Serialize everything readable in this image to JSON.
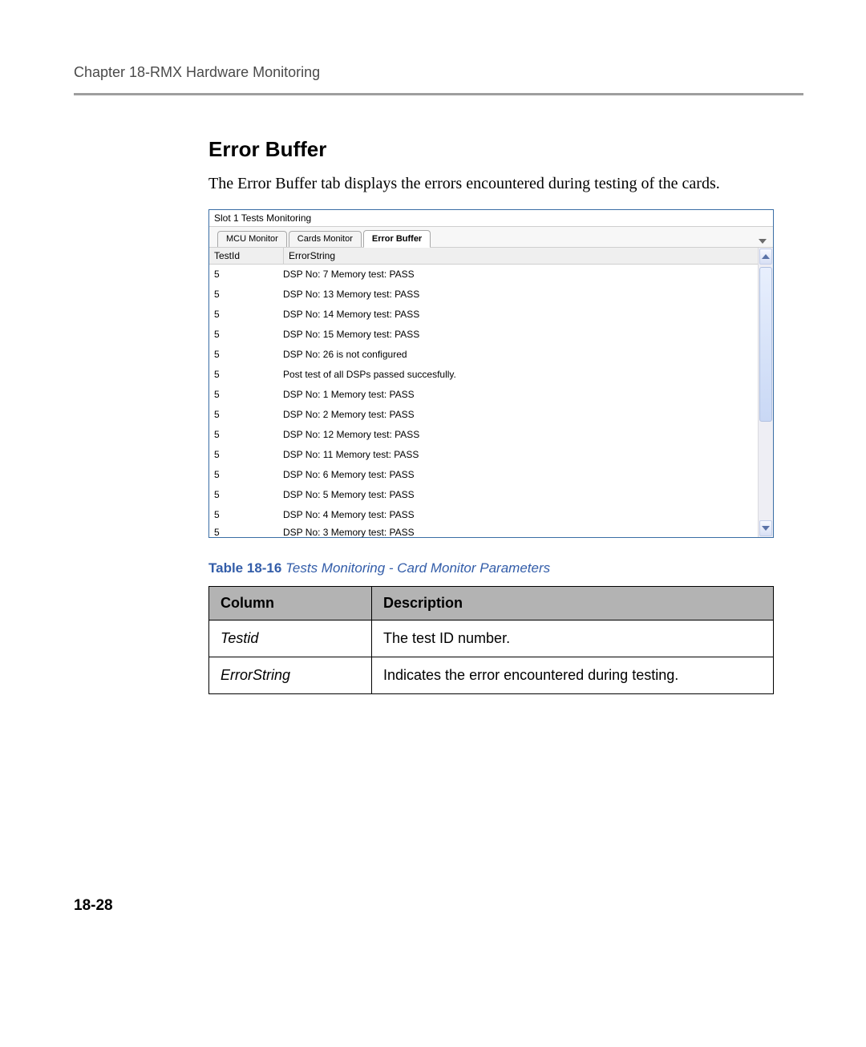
{
  "page": {
    "chapter_title": "Chapter 18-RMX Hardware Monitoring",
    "page_number": "18-28"
  },
  "section": {
    "heading": "Error Buffer",
    "intro": "The Error Buffer tab displays the errors encountered during testing of the cards."
  },
  "shot": {
    "window_title": "Slot 1 Tests Monitoring",
    "tabs": [
      "MCU Monitor",
      "Cards Monitor",
      "Error Buffer"
    ],
    "active_tab_index": 2,
    "columns": {
      "testid": "TestId",
      "errorstring": "ErrorString"
    },
    "rows": [
      {
        "testid": "5",
        "err": "DSP No: 7 Memory test: PASS"
      },
      {
        "testid": "5",
        "err": "DSP No: 13 Memory test: PASS"
      },
      {
        "testid": "5",
        "err": "DSP No: 14 Memory test: PASS"
      },
      {
        "testid": "5",
        "err": "DSP No: 15 Memory test: PASS"
      },
      {
        "testid": "5",
        "err": "DSP No: 26 is not configured"
      },
      {
        "testid": "5",
        "err": "Post test of all DSPs passed succesfully."
      },
      {
        "testid": "5",
        "err": "DSP No: 1 Memory test: PASS"
      },
      {
        "testid": "5",
        "err": "DSP No: 2 Memory test: PASS"
      },
      {
        "testid": "5",
        "err": "DSP No: 12 Memory test: PASS"
      },
      {
        "testid": "5",
        "err": "DSP No: 11 Memory test: PASS"
      },
      {
        "testid": "5",
        "err": "DSP No: 6 Memory test: PASS"
      },
      {
        "testid": "5",
        "err": "DSP No: 5 Memory test: PASS"
      },
      {
        "testid": "5",
        "err": "DSP No: 4 Memory test: PASS"
      },
      {
        "testid": "5",
        "err": "DSP No: 3 Memory test: PASS"
      }
    ]
  },
  "table": {
    "caption_label": "Table 18-16",
    "caption_title": "Tests Monitoring - Card Monitor Parameters",
    "head": {
      "column": "Column",
      "description": "Description"
    },
    "rows": [
      {
        "column": "Testid",
        "description": "The test ID number."
      },
      {
        "column": "ErrorString",
        "description": "Indicates the error encountered during testing."
      }
    ]
  }
}
